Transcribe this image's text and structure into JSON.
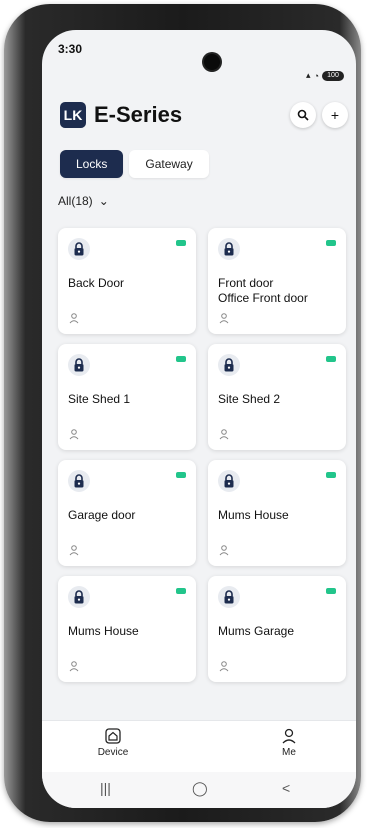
{
  "status_bar": {
    "time": "3:30",
    "battery_label": "100"
  },
  "app": {
    "logo_text": "LK",
    "title": "E-Series"
  },
  "tabs": [
    {
      "label": "Locks",
      "active": true
    },
    {
      "label": "Gateway",
      "active": false
    }
  ],
  "filter": {
    "label": "All(18)"
  },
  "locks": [
    {
      "name": "Back Door"
    },
    {
      "name": "Front door\nOffice Front door"
    },
    {
      "name": "Site Shed 1"
    },
    {
      "name": "Site Shed 2"
    },
    {
      "name": "Garage door"
    },
    {
      "name": "Mums House"
    },
    {
      "name": "Mums House"
    },
    {
      "name": "Mums Garage"
    }
  ],
  "bottom_nav": [
    {
      "label": "Device",
      "icon": "house-lock-icon"
    },
    {
      "label": "Me",
      "icon": "person-icon"
    }
  ],
  "colors": {
    "brand_navy": "#1d2c4e",
    "battery_green": "#22c58b",
    "background": "#f2f3f5"
  }
}
